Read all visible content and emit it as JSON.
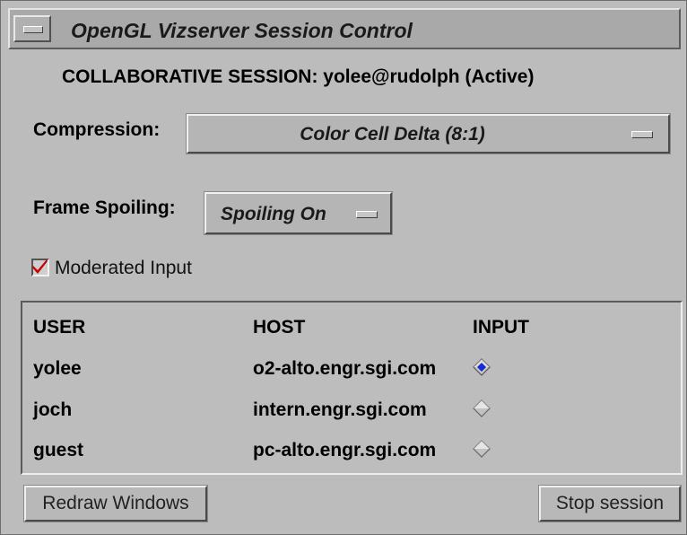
{
  "window": {
    "title": "OpenGL Vizserver Session Control"
  },
  "session": {
    "label": "COLLABORATIVE SESSION: yolee@rudolph (Active)"
  },
  "compression": {
    "label": "Compression:",
    "value": "Color Cell Delta (8:1)"
  },
  "frame_spoiling": {
    "label": "Frame Spoiling:",
    "value": "Spoiling On"
  },
  "moderated_input": {
    "label": "Moderated Input",
    "checked": true
  },
  "table": {
    "headers": [
      "USER",
      "HOST",
      "INPUT"
    ],
    "rows": [
      {
        "user": "yolee",
        "host": "o2-alto.engr.sgi.com",
        "input_selected": true
      },
      {
        "user": "joch",
        "host": "intern.engr.sgi.com",
        "input_selected": false
      },
      {
        "user": "guest",
        "host": "pc-alto.engr.sgi.com",
        "input_selected": false
      }
    ]
  },
  "buttons": {
    "redraw": "Redraw Windows",
    "stop": "Stop session"
  },
  "colors": {
    "background": "#bcbcbc",
    "check_mark": "#cc0000",
    "radio_selected": "#1a2bd0"
  },
  "icons": {
    "window_menu": "window-menu-icon",
    "option_indicator": "option-menu-indicator-icon",
    "checkbox": "checkmark-icon",
    "radio": "diamond-radio-icon"
  }
}
